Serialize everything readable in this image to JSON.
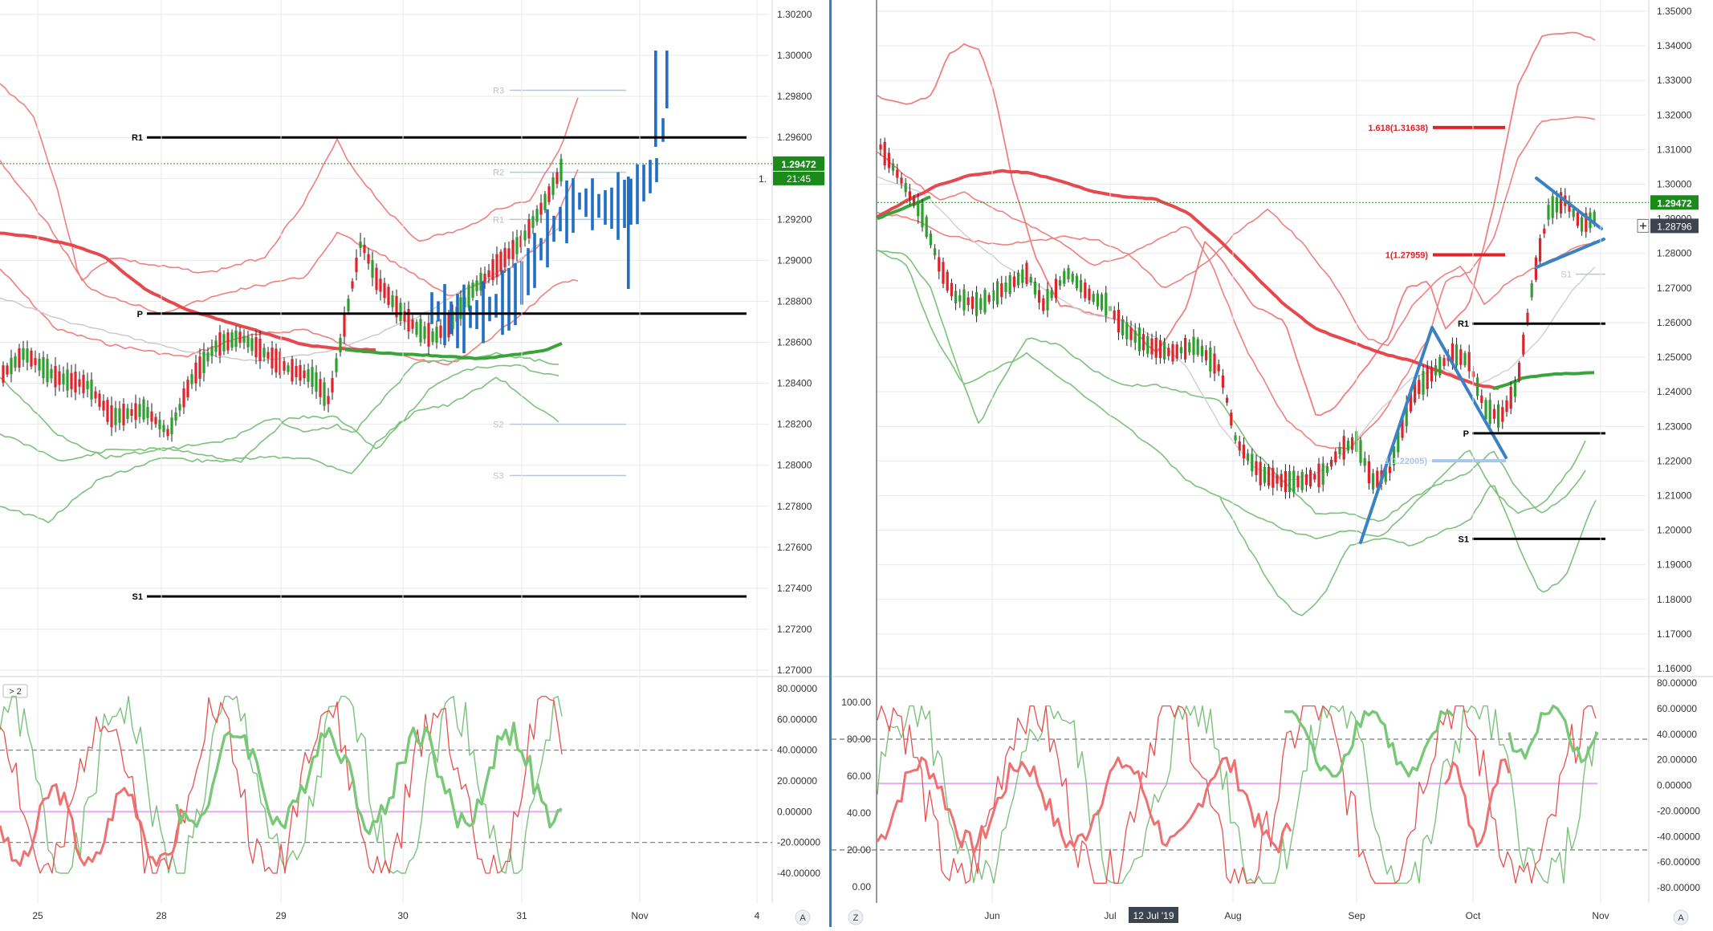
{
  "colors": {
    "background": "#ffffff",
    "axis_text": "#333333",
    "grid": "#e9e9e9",
    "bull": "#2ca02c",
    "bear": "#e0222a",
    "sma_red": "#e5484d",
    "sma_green": "#3aa33a",
    "bollinger_red": "#f08080",
    "bollinger_green": "#7cc27c",
    "level_line": "#000000",
    "price_tag": "#1a8a1a",
    "projection": "#1f6fc4",
    "pattern_blue": "#3b82c4",
    "fib_red": "#e0222a",
    "light_blue": "#a9c6e8",
    "divider": "#2f7fd0",
    "pivot_light": "#b7c7d8",
    "osc_mid": "#e6a8f0"
  },
  "chart_data": [
    {
      "id": "left-price",
      "type": "line",
      "title": "",
      "instrument_style": "candlestick",
      "x_ticks": [
        "25",
        "28",
        "29",
        "30",
        "31",
        "Nov",
        "4"
      ],
      "y_ticks": [
        "1.30200",
        "1.30000",
        "1.29800",
        "1.29600",
        "1.29400",
        "1.29200",
        "1.29000",
        "1.28800",
        "1.28600",
        "1.28400",
        "1.28200",
        "1.28000",
        "1.27800",
        "1.27600",
        "1.27400",
        "1.27200",
        "1.27000"
      ],
      "ylim": [
        1.2695,
        1.3025
      ],
      "levels": [
        {
          "label": "R1",
          "value": 1.296
        },
        {
          "label": "P",
          "value": 1.2874
        },
        {
          "label": "S1",
          "value": 1.2736
        }
      ],
      "faint_levels": [
        {
          "label": "R3",
          "value": 1.2983
        },
        {
          "label": "R2",
          "value": 1.2943
        },
        {
          "label": "R1",
          "value": 1.292
        },
        {
          "label": "S2",
          "value": 1.282
        },
        {
          "label": "S3",
          "value": 1.2795
        }
      ],
      "current_price": "1.29472",
      "countdown": "21:45",
      "price_tag_partial": "1."
    },
    {
      "id": "left-oscillator",
      "type": "line",
      "label": "> 2",
      "y_ticks": [
        "80.00000",
        "60.00000",
        "40.00000",
        "20.00000",
        "0.00000",
        "-20.00000",
        "-40.00000"
      ],
      "ylim": [
        -60,
        85
      ],
      "dashed_levels": [
        40,
        -20
      ],
      "mid_level": 0
    },
    {
      "id": "right-price",
      "type": "line",
      "title": "",
      "instrument_style": "candlestick",
      "x_ticks": [
        "Jun",
        "Jul",
        "Aug",
        "Sep",
        "Oct",
        "Nov"
      ],
      "crosshair_date": "12 Jul '19",
      "y_ticks": [
        "1.35000",
        "1.34000",
        "1.33000",
        "1.32000",
        "1.31000",
        "1.30000",
        "1.29000",
        "1.28000",
        "1.27000",
        "1.26000",
        "1.25000",
        "1.24000",
        "1.23000",
        "1.22000",
        "1.21000",
        "1.20000",
        "1.19000",
        "1.18000",
        "1.17000",
        "1.16000"
      ],
      "ylim": [
        1.155,
        1.3525
      ],
      "levels": [
        {
          "label": "R1",
          "value": 1.2597
        },
        {
          "label": "P",
          "value": 1.228
        },
        {
          "label": "S1",
          "value": 1.1975
        }
      ],
      "faint_levels": [
        {
          "label": "S1",
          "value": 1.274
        }
      ],
      "fib_levels": [
        {
          "label": "1.618(1.31638)",
          "value": 1.31638
        },
        {
          "label": "1(1.27959)",
          "value": 1.27959
        },
        {
          "label": "1(1.22005)",
          "value": 1.22005
        }
      ],
      "current_price": "1.29472",
      "crosshair_price": "1.28796"
    },
    {
      "id": "right-oscillator",
      "type": "line",
      "y_ticks_left": [
        "100.00",
        "80.00",
        "60.00",
        "40.00",
        "20.00",
        "0.00"
      ],
      "y_ticks_right": [
        "80.00000",
        "60.00000",
        "40.00000",
        "20.00000",
        "0.00000",
        "-20.00000",
        "-40.00000",
        "-60.00000",
        "-80.00000"
      ],
      "dashed_levels": [
        80,
        20
      ],
      "mid_level": 56
    }
  ],
  "toolbar": {
    "left_corner_button": "A",
    "right_left_corner_button": "Z",
    "right_corner_button": "A"
  }
}
